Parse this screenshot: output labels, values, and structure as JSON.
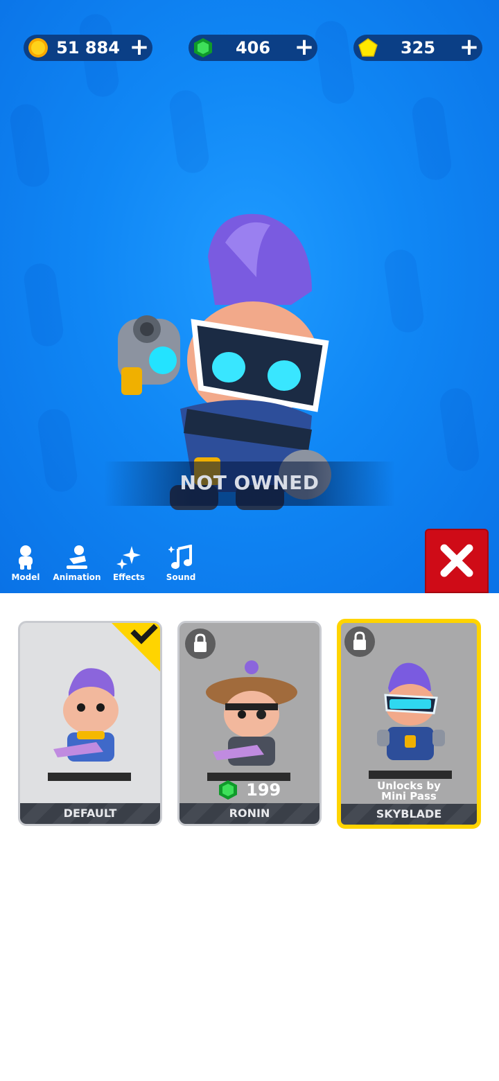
{
  "currencies": [
    {
      "name": "coins",
      "icon": "coin-icon",
      "value": "51 884",
      "color": "#ffc400"
    },
    {
      "name": "gems",
      "icon": "gem-icon",
      "value": "406",
      "color": "#22c03a"
    },
    {
      "name": "stars",
      "icon": "star-gem-icon",
      "value": "325",
      "color": "#ffe800"
    }
  ],
  "preview": {
    "status": "NOT OWNED"
  },
  "tools": [
    {
      "label": "Model",
      "icon": "model-icon"
    },
    {
      "label": "Animation",
      "icon": "animation-icon"
    },
    {
      "label": "Effects",
      "icon": "effects-icon"
    },
    {
      "label": "Sound",
      "icon": "sound-icon"
    }
  ],
  "close_icon": "close-icon",
  "skins": [
    {
      "name": "DEFAULT",
      "state": "selected",
      "icon": "checkmark-icon"
    },
    {
      "name": "RONIN",
      "state": "locked",
      "price": "199",
      "price_icon": "gem-icon"
    },
    {
      "name": "SKYBLADE",
      "state": "locked",
      "unlock_line1": "Unlocks by",
      "unlock_line2": "Mini Pass",
      "highlight_color": "#ffd400"
    }
  ]
}
